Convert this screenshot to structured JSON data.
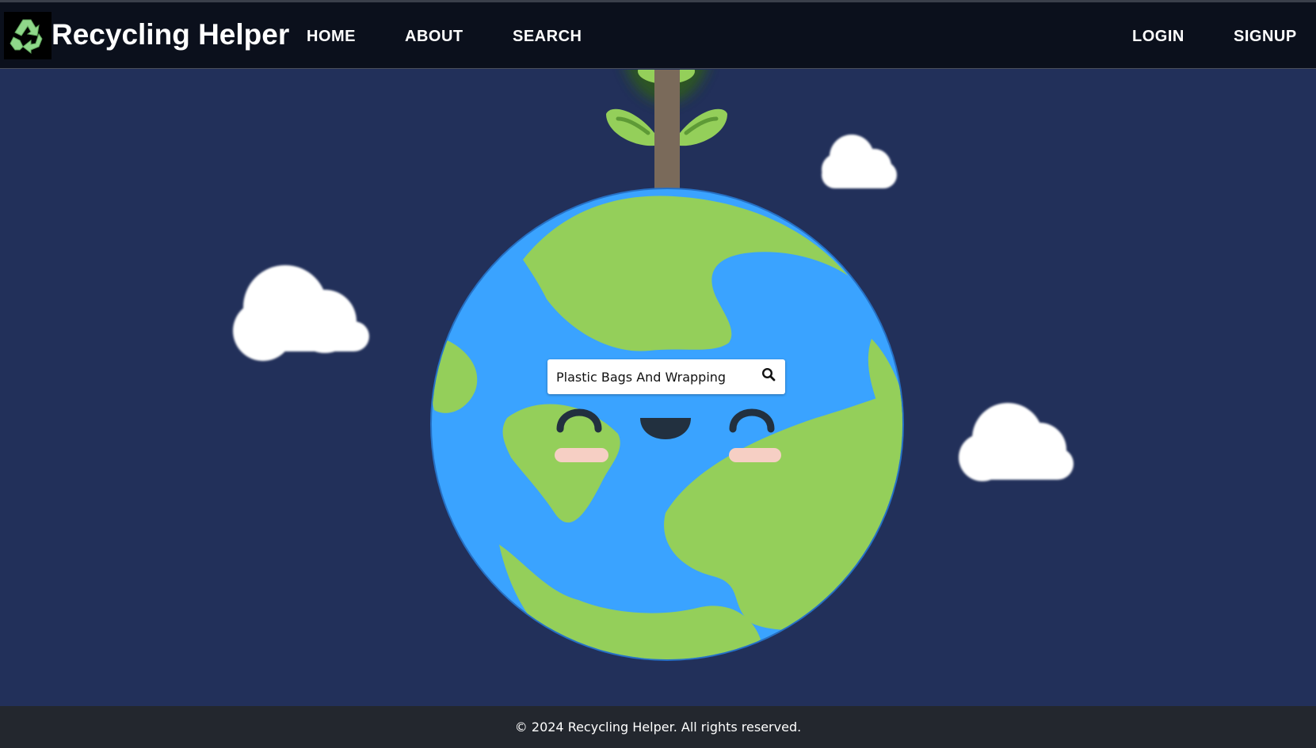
{
  "header": {
    "brand": "Recycling Helper",
    "logo_icon": "recycle-icon",
    "nav": {
      "home": "HOME",
      "about": "ABOUT",
      "search": "SEARCH",
      "login": "LOGIN",
      "signup": "SIGNUP"
    }
  },
  "search": {
    "value": "Plastic Bags And Wrapping",
    "icon": "search-icon"
  },
  "footer": {
    "text": "© 2024 Recycling Helper. All rights reserved."
  },
  "colors": {
    "background": "#22305a",
    "navbar": "#0b101c",
    "footer": "#23272e",
    "ocean": "#3aa3ff",
    "land": "#94cf5a",
    "recycle_green": "#8fd78a"
  }
}
